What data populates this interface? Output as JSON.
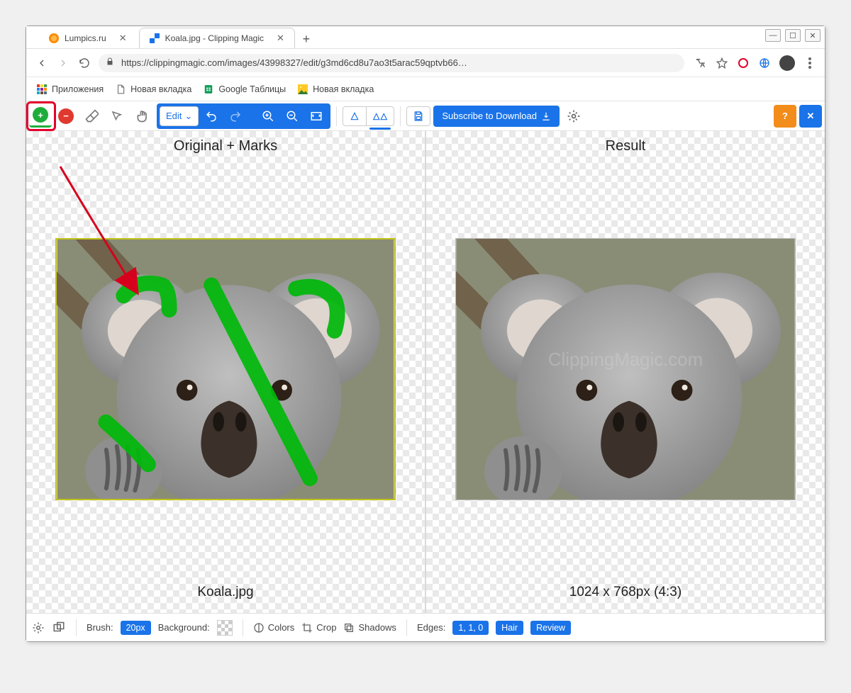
{
  "window_controls": {
    "minimize": "—",
    "maximize": "☐",
    "close": "✕"
  },
  "tabs": [
    {
      "title": "Lumpics.ru",
      "active": false
    },
    {
      "title": "Koala.jpg - Clipping Magic",
      "active": true
    }
  ],
  "addressbar": {
    "url_display": "https://clippingmagic.com/images/43998327/edit/g3md6cd8u7ao3t5arac59qptvb66…"
  },
  "bookmarks": [
    {
      "label": "Приложения",
      "icon": "apps"
    },
    {
      "label": "Новая вкладка",
      "icon": "page"
    },
    {
      "label": "Google Таблицы",
      "icon": "sheets"
    },
    {
      "label": "Новая вкладка",
      "icon": "img"
    }
  ],
  "toolbar": {
    "edit_label": "Edit",
    "subscribe_label": "Subscribe to Download",
    "help_label": "?",
    "close_label": "✕"
  },
  "panels": {
    "left_title": "Original + Marks",
    "right_title": "Result",
    "left_footer": "Koala.jpg",
    "right_footer": "1024 x 768px (4:3)"
  },
  "bottombar": {
    "brush_label": "Brush:",
    "brush_value": "20px",
    "background_label": "Background:",
    "colors_label": "Colors",
    "crop_label": "Crop",
    "shadows_label": "Shadows",
    "edges_label": "Edges:",
    "edges_value": "1, 1, 0",
    "hair_label": "Hair",
    "review_label": "Review"
  }
}
